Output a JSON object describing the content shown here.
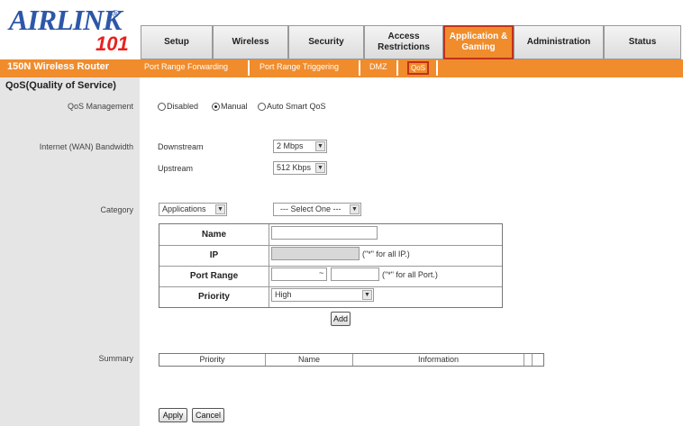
{
  "brand": {
    "logo_main": "AIRLINK",
    "logo_reg": "®",
    "logo_num": "101",
    "product": "150N Wireless Router"
  },
  "nav": {
    "tabs": [
      {
        "label": "Setup"
      },
      {
        "label": "Wireless"
      },
      {
        "label": "Security"
      },
      {
        "label": "Access Restrictions"
      },
      {
        "label": "Application & Gaming"
      },
      {
        "label": "Administration"
      },
      {
        "label": "Status"
      }
    ],
    "active_index": 4
  },
  "subnav": {
    "items": [
      "Port Range Forwarding",
      "Port Range Triggering",
      "DMZ",
      "QoS"
    ],
    "active_index": 3
  },
  "section_title": "QoS(Quality of Service)",
  "qos_management": {
    "label": "QoS Management",
    "options": [
      "Disabled",
      "Manual",
      "Auto Smart QoS"
    ],
    "selected": "Manual"
  },
  "bandwidth": {
    "label": "Internet (WAN) Bandwidth",
    "downstream_label": "Downstream",
    "downstream_value": "2 Mbps",
    "upstream_label": "Upstream",
    "upstream_value": "512 Kbps"
  },
  "category": {
    "label": "Category",
    "type_value": "Applications",
    "select_one": "--- Select One ---",
    "rows": {
      "name_label": "Name",
      "ip_label": "IP",
      "ip_hint": "(\"*\" for all IP.)",
      "port_label": "Port Range",
      "port_dash": "~",
      "port_hint": "(\"*\" for all Port.)",
      "priority_label": "Priority",
      "priority_value": "High"
    },
    "add_button": "Add"
  },
  "summary": {
    "label": "Summary",
    "columns": [
      "Priority",
      "Name",
      "Information",
      "",
      ""
    ]
  },
  "actions": {
    "apply": "Apply",
    "cancel": "Cancel"
  },
  "colors": {
    "accent": "#f08c2c",
    "highlight_border": "#c0321c",
    "logo_blue": "#2d57a8",
    "logo_red": "#e8201e"
  }
}
